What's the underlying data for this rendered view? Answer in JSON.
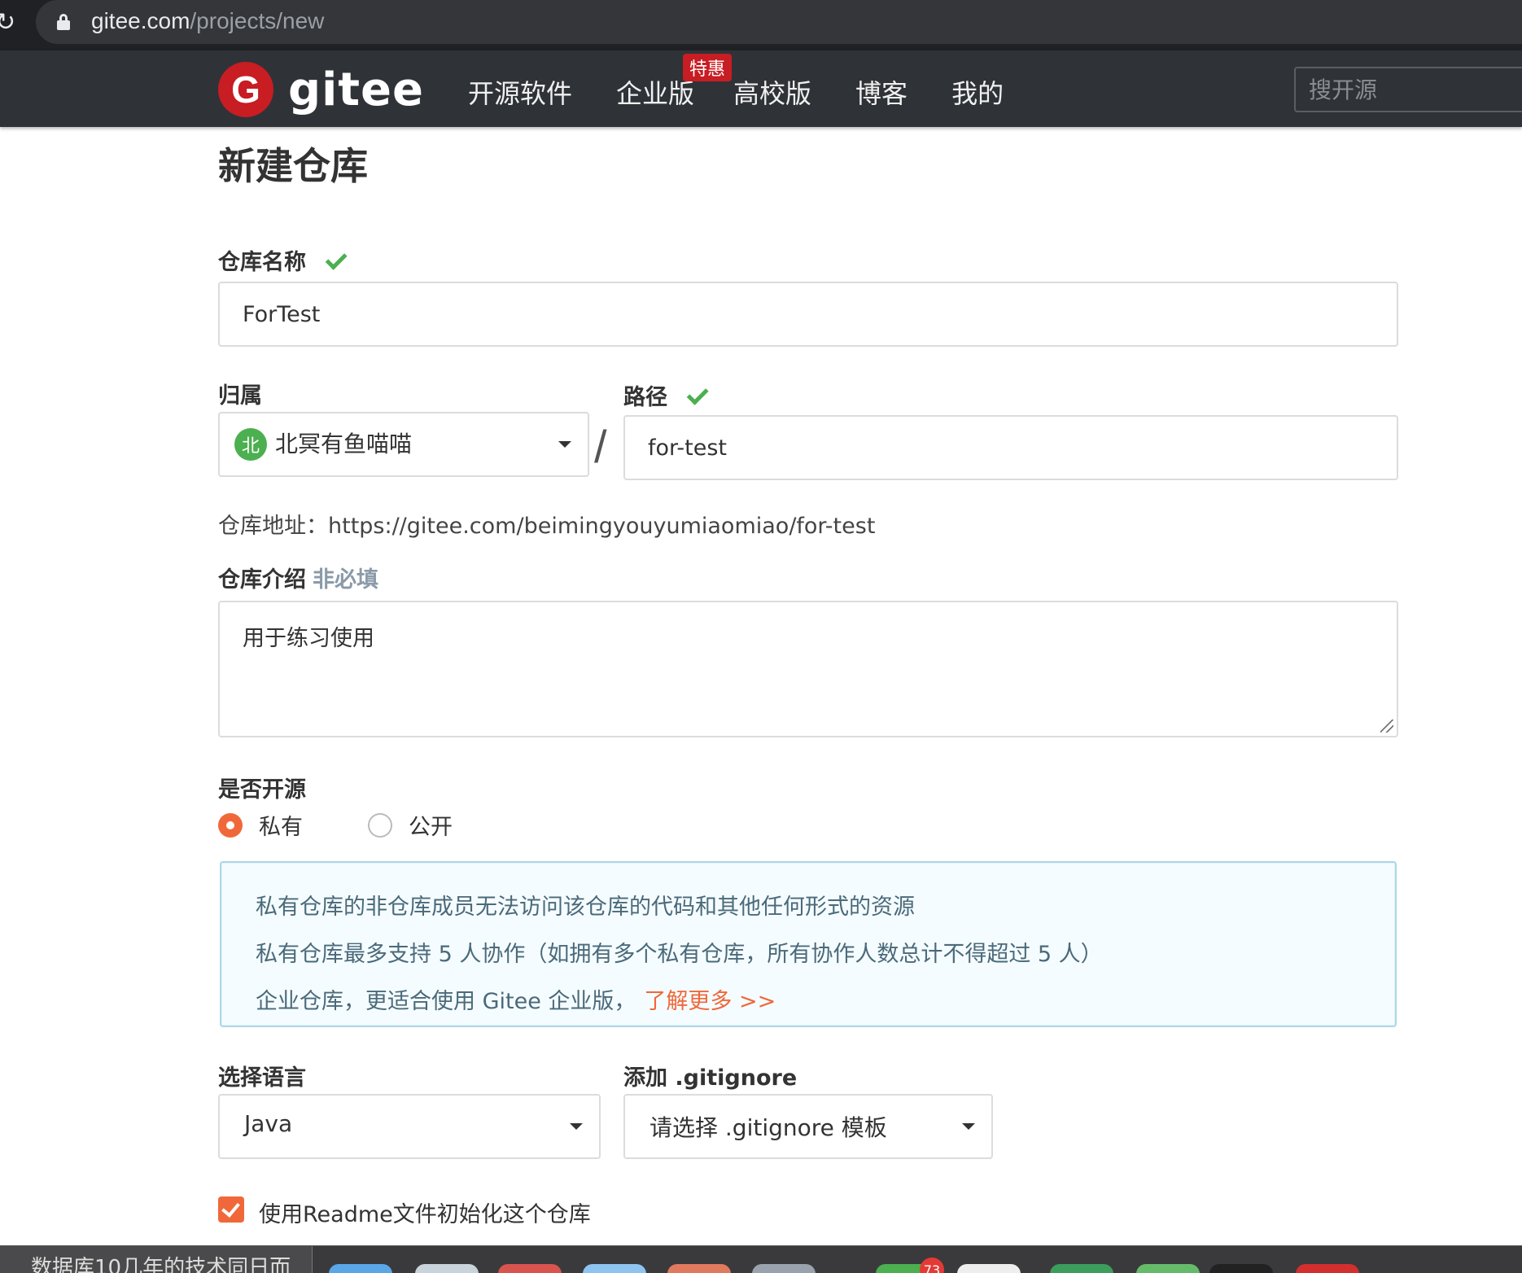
{
  "browser": {
    "url_host": "gitee.com",
    "url_path": "/projects/new"
  },
  "header": {
    "logo_mark": "G",
    "logo_text": "gitee",
    "nav": [
      {
        "label": "开源软件"
      },
      {
        "label": "企业版",
        "badge": "特惠"
      },
      {
        "label": "高校版"
      },
      {
        "label": "博客"
      },
      {
        "label": "我的"
      }
    ],
    "search_placeholder": "搜开源"
  },
  "form": {
    "title": "新建仓库",
    "repo_name_label": "仓库名称",
    "repo_name_value": "ForTest",
    "owner_label": "归属",
    "owner_avatar": "北",
    "owner_name": "北冥有鱼喵喵",
    "slash": "/",
    "path_label": "路径",
    "path_value": "for-test",
    "repo_address": "仓库地址：https://gitee.com/beimingyouyumiaomiao/for-test",
    "intro_label": "仓库介绍",
    "intro_optional": "非必填",
    "intro_value": "用于练习使用",
    "open_source_label": "是否开源",
    "visibility_options": [
      {
        "label": "私有",
        "checked": true
      },
      {
        "label": "公开",
        "checked": false
      }
    ],
    "info_lines": [
      "私有仓库的非仓库成员无法访问该仓库的代码和其他任何形式的资源",
      "私有仓库最多支持 5 人协作（如拥有多个私有仓库，所有协作人数总计不得超过 5 人）",
      "企业仓库，更适合使用 Gitee 企业版，"
    ],
    "learn_more": "了解更多 >>",
    "language_label": "选择语言",
    "language_value": "Java",
    "gitignore_label": "添加 .gitignore",
    "gitignore_value": "请选择 .gitignore 模板",
    "readme_label": "使用Readme文件初始化这个仓库",
    "readme_checked": true
  },
  "dock": {
    "window_title": "数据库10几年的技术同日而",
    "badge_count": "73"
  },
  "colors": {
    "header_bg": "#2f3338",
    "brand_red": "#c71d23",
    "accent_orange": "#f0683a",
    "check_green": "#4caf50"
  }
}
